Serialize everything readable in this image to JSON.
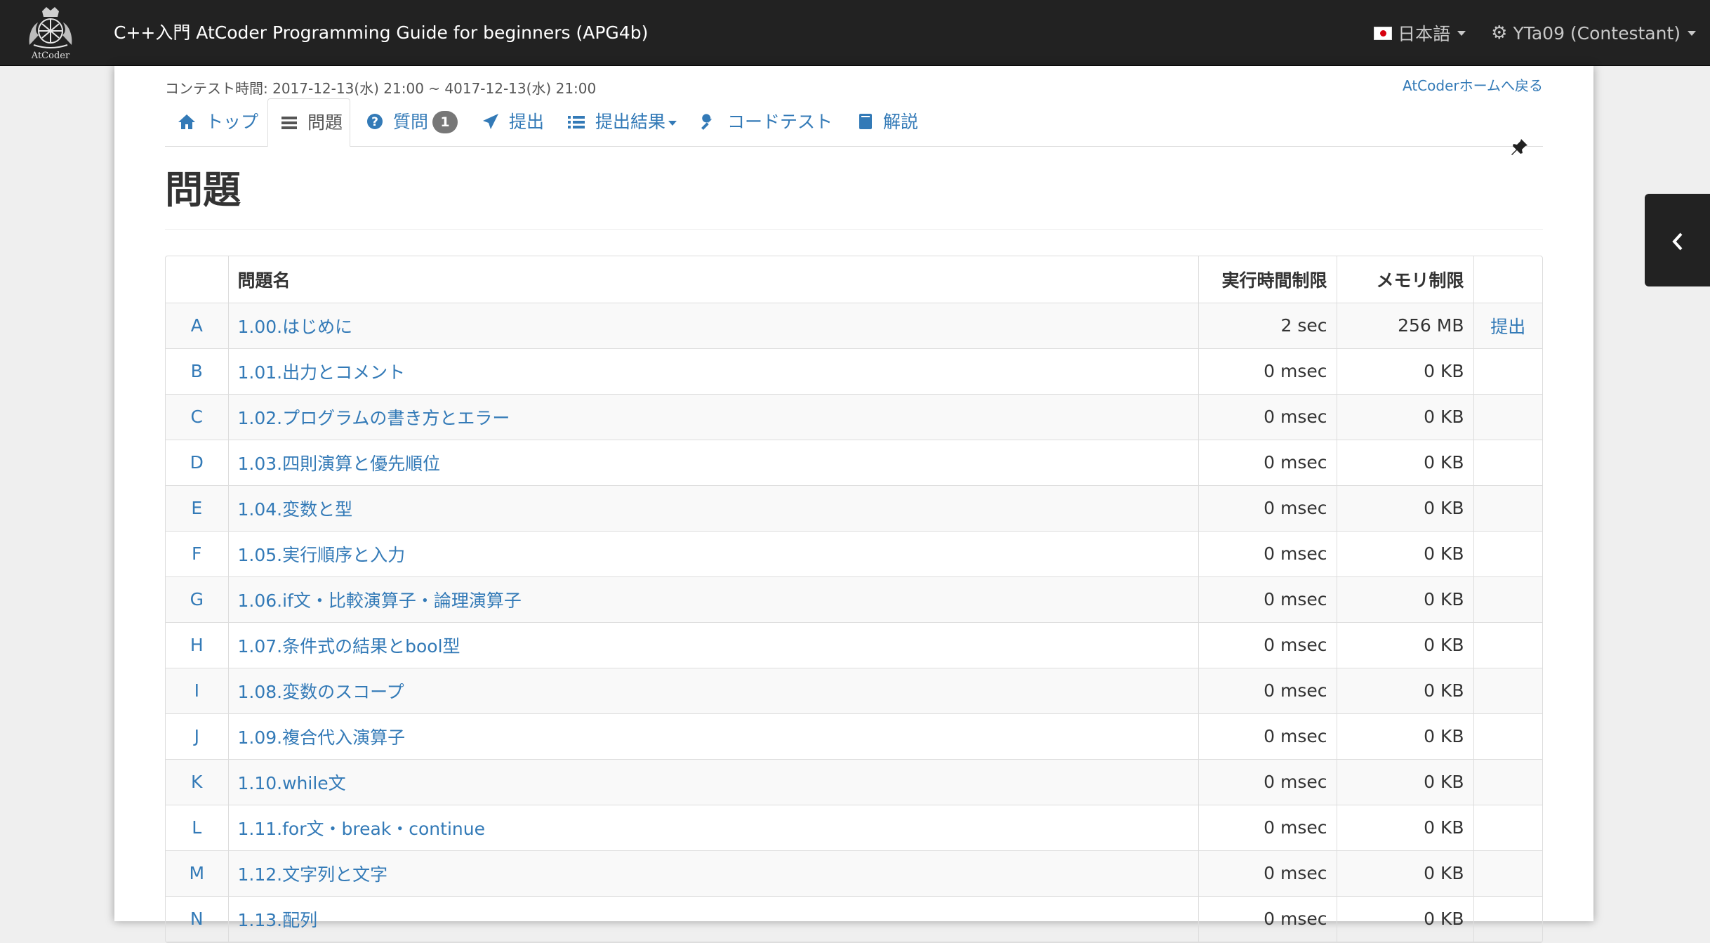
{
  "navbar": {
    "logo_text": "AtCoder",
    "brand": "C++入門 AtCoder Programming Guide for beginners (APG4b)",
    "language": "日本語",
    "user": "YTa09 (Contestant)"
  },
  "contest": {
    "time": "コンテスト時間: 2017-12-13(水) 21:00 ~ 4017-12-13(水) 21:00",
    "back_link": "AtCoderホームへ戻る"
  },
  "tabs": [
    {
      "label": "トップ",
      "icon": "home-icon"
    },
    {
      "label": "問題",
      "icon": "list-icon",
      "active": true
    },
    {
      "label": "質問",
      "icon": "question-circle-icon",
      "badge": "1"
    },
    {
      "label": "提出",
      "icon": "send-icon"
    },
    {
      "label": "提出結果",
      "icon": "list-ul-icon",
      "dropdown": true
    },
    {
      "label": "コードテスト",
      "icon": "wrench-icon"
    },
    {
      "label": "解説",
      "icon": "book-icon"
    }
  ],
  "page": {
    "title": "問題"
  },
  "table": {
    "headers": [
      "",
      "問題名",
      "実行時間制限",
      "メモリ制限",
      ""
    ],
    "rows": [
      {
        "letter": "A",
        "name": "1.00.はじめに",
        "time": "2 sec",
        "memory": "256 MB",
        "submit": "提出"
      },
      {
        "letter": "B",
        "name": "1.01.出力とコメント",
        "time": "0 msec",
        "memory": "0 KB",
        "submit": ""
      },
      {
        "letter": "C",
        "name": "1.02.プログラムの書き方とエラー",
        "time": "0 msec",
        "memory": "0 KB",
        "submit": ""
      },
      {
        "letter": "D",
        "name": "1.03.四則演算と優先順位",
        "time": "0 msec",
        "memory": "0 KB",
        "submit": ""
      },
      {
        "letter": "E",
        "name": "1.04.変数と型",
        "time": "0 msec",
        "memory": "0 KB",
        "submit": ""
      },
      {
        "letter": "F",
        "name": "1.05.実行順序と入力",
        "time": "0 msec",
        "memory": "0 KB",
        "submit": ""
      },
      {
        "letter": "G",
        "name": "1.06.if文・比較演算子・論理演算子",
        "time": "0 msec",
        "memory": "0 KB",
        "submit": ""
      },
      {
        "letter": "H",
        "name": "1.07.条件式の結果とbool型",
        "time": "0 msec",
        "memory": "0 KB",
        "submit": ""
      },
      {
        "letter": "I",
        "name": "1.08.変数のスコープ",
        "time": "0 msec",
        "memory": "0 KB",
        "submit": ""
      },
      {
        "letter": "J",
        "name": "1.09.複合代入演算子",
        "time": "0 msec",
        "memory": "0 KB",
        "submit": ""
      },
      {
        "letter": "K",
        "name": "1.10.while文",
        "time": "0 msec",
        "memory": "0 KB",
        "submit": ""
      },
      {
        "letter": "L",
        "name": "1.11.for文・break・continue",
        "time": "0 msec",
        "memory": "0 KB",
        "submit": ""
      },
      {
        "letter": "M",
        "name": "1.12.文字列と文字",
        "time": "0 msec",
        "memory": "0 KB",
        "submit": ""
      },
      {
        "letter": "N",
        "name": "1.13.配列",
        "time": "0 msec",
        "memory": "0 KB",
        "submit": ""
      }
    ]
  },
  "colors": {
    "navbar_bg": "#222222",
    "link": "#337ab7",
    "badge": "#777777",
    "page_bg": "#efefef"
  }
}
